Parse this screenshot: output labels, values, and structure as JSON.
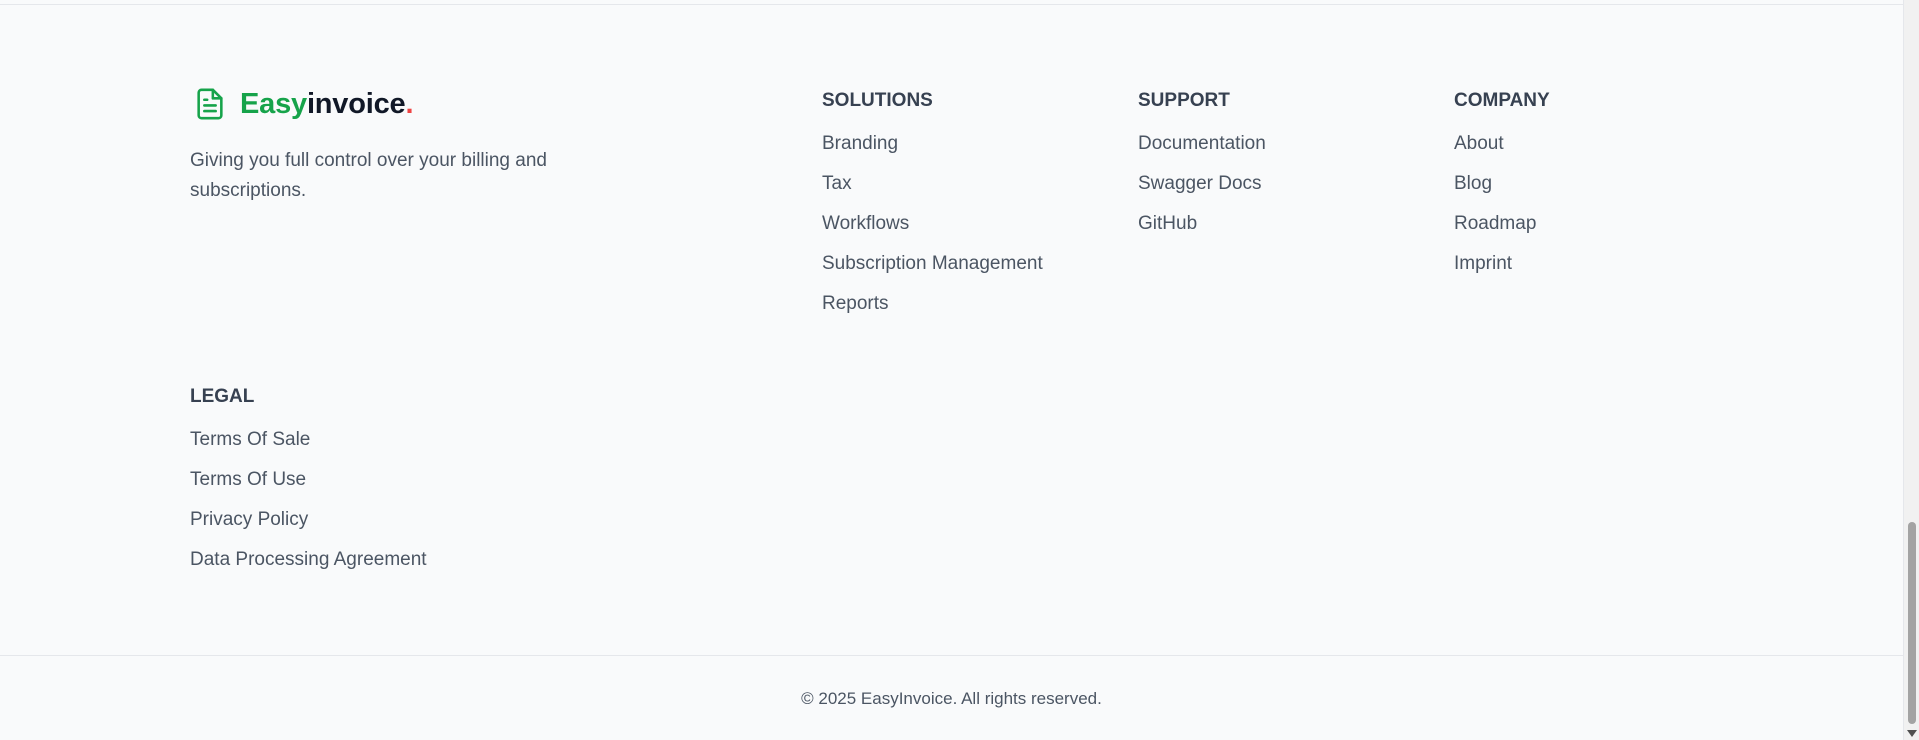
{
  "brand": {
    "name_part1": "Easy",
    "name_part2": "invoice",
    "name_dot": ".",
    "icon": "document-icon",
    "tagline": "Giving you full control over your billing and subscriptions.",
    "colors": {
      "primary": "#16a34a",
      "dark": "#111827",
      "dot": "#ef4444"
    }
  },
  "footer": {
    "solutions": {
      "heading": "SOLUTIONS",
      "links": [
        "Branding",
        "Tax",
        "Workflows",
        "Subscription Management",
        "Reports"
      ]
    },
    "support": {
      "heading": "SUPPORT",
      "links": [
        "Documentation",
        "Swagger Docs",
        "GitHub"
      ]
    },
    "company": {
      "heading": "COMPANY",
      "links": [
        "About",
        "Blog",
        "Roadmap",
        "Imprint"
      ]
    },
    "legal": {
      "heading": "LEGAL",
      "links": [
        "Terms Of Sale",
        "Terms Of Use",
        "Privacy Policy",
        "Data Processing Agreement"
      ]
    },
    "copyright": "© 2025 EasyInvoice. All rights reserved."
  }
}
